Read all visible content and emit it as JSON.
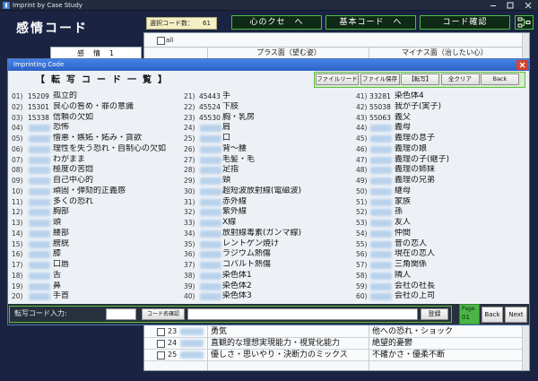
{
  "app": {
    "title": "Imprint by Case Study",
    "icons": {
      "app": "app-icon",
      "minimize": "minimize-icon",
      "maximize": "maximize-icon",
      "close": "close-icon"
    }
  },
  "colors": {
    "background": "#1a2442",
    "accent_green": "#4fbf3f",
    "dialog_title": "#3572d6",
    "close_red": "#d9412e",
    "count_box": "#f4efc4",
    "page_box": "#4cb548"
  },
  "main": {
    "heading": "感情コード",
    "selected_count_label": "選択コード数：",
    "selected_count": "61",
    "nav": [
      "心のクセ　へ",
      "基本コード　へ",
      "コード確認"
    ],
    "nav_icon": "network-icon",
    "group_label": "感　情　1",
    "all_label": "all",
    "columns": {
      "plus": "プラス面（望む姿）",
      "minus": "マイナス面（治したい心）"
    },
    "rows": [
      {
        "no": "23",
        "plus": "勇気",
        "minus": "他への恐れ・ショック"
      },
      {
        "no": "24",
        "plus": "直観的な理想実現能力・視覚化能力",
        "minus": "絶望的憂鬱"
      },
      {
        "no": "25",
        "plus": "優しさ・思いやり・決断力のミックス",
        "minus": "不確かさ・優柔不断"
      }
    ]
  },
  "dialog": {
    "title": "Imprinting Code",
    "close_icon": "close-icon",
    "heading": "【転写コード一覧】",
    "toolbar": [
      "ファイルリード",
      "ファイル保存",
      "【転写】",
      "全クリア",
      "Back"
    ],
    "list": [
      {
        "no": "01)",
        "code": "15209",
        "text": "孤立的"
      },
      {
        "no": "02)",
        "code": "15301",
        "text": "良心の咎め・罪の意識"
      },
      {
        "no": "03)",
        "code": "15338",
        "text": "信頼の欠如"
      },
      {
        "no": "04)",
        "code": "",
        "text": "恐怖"
      },
      {
        "no": "05)",
        "code": "",
        "text": "憎悪・嫉妬・妬み・貪欲"
      },
      {
        "no": "06)",
        "code": "",
        "text": "理性を失う恐れ・自制心の欠如"
      },
      {
        "no": "07)",
        "code": "",
        "text": "わがまま"
      },
      {
        "no": "08)",
        "code": "",
        "text": "極度の苦悶"
      },
      {
        "no": "09)",
        "code": "",
        "text": "自己中心的"
      },
      {
        "no": "10)",
        "code": "",
        "text": "頑固・弾劾的正義感"
      },
      {
        "no": "11)",
        "code": "",
        "text": "多くの恐れ"
      },
      {
        "no": "12)",
        "code": "",
        "text": "胸部"
      },
      {
        "no": "13)",
        "code": "",
        "text": "頭"
      },
      {
        "no": "14)",
        "code": "",
        "text": "腰部"
      },
      {
        "no": "15)",
        "code": "",
        "text": "膀胱"
      },
      {
        "no": "16)",
        "code": "",
        "text": "膝"
      },
      {
        "no": "17)",
        "code": "",
        "text": "口唇"
      },
      {
        "no": "18)",
        "code": "",
        "text": "舌"
      },
      {
        "no": "19)",
        "code": "",
        "text": "鼻"
      },
      {
        "no": "20)",
        "code": "",
        "text": "手首"
      },
      {
        "no": "21)",
        "code": "45443",
        "text": "手"
      },
      {
        "no": "22)",
        "code": "45524",
        "text": "下肢"
      },
      {
        "no": "23)",
        "code": "45530",
        "text": "胸・乳房"
      },
      {
        "no": "24)",
        "code": "",
        "text": "肩"
      },
      {
        "no": "25)",
        "code": "",
        "text": "口"
      },
      {
        "no": "26)",
        "code": "",
        "text": "背〜腰"
      },
      {
        "no": "27)",
        "code": "",
        "text": "毛髪・毛"
      },
      {
        "no": "28)",
        "code": "",
        "text": "足指"
      },
      {
        "no": "29)",
        "code": "",
        "text": "頸"
      },
      {
        "no": "30)",
        "code": "",
        "text": "超短波放射線(電磁波)"
      },
      {
        "no": "31)",
        "code": "",
        "text": "赤外線"
      },
      {
        "no": "32)",
        "code": "",
        "text": "紫外線"
      },
      {
        "no": "33)",
        "code": "",
        "text": "X線"
      },
      {
        "no": "34)",
        "code": "",
        "text": "放射線毒素(ガンマ線)"
      },
      {
        "no": "35)",
        "code": "",
        "text": "レントゲン焼け"
      },
      {
        "no": "36)",
        "code": "",
        "text": "ラジウム熱傷"
      },
      {
        "no": "37)",
        "code": "",
        "text": "コバルト熱傷"
      },
      {
        "no": "38)",
        "code": "",
        "text": "染色体1"
      },
      {
        "no": "39)",
        "code": "",
        "text": "染色体2"
      },
      {
        "no": "40)",
        "code": "",
        "text": "染色体3"
      },
      {
        "no": "41)",
        "code": "33281",
        "text": "染色体4"
      },
      {
        "no": "42)",
        "code": "55038",
        "text": "我が子(実子)"
      },
      {
        "no": "43)",
        "code": "55063",
        "text": "義父"
      },
      {
        "no": "44)",
        "code": "",
        "text": "義母"
      },
      {
        "no": "45)",
        "code": "",
        "text": "義理の息子"
      },
      {
        "no": "46)",
        "code": "",
        "text": "義理の娘"
      },
      {
        "no": "47)",
        "code": "",
        "text": "義理の子(継子)"
      },
      {
        "no": "48)",
        "code": "",
        "text": "義理の姉妹"
      },
      {
        "no": "49)",
        "code": "",
        "text": "義理の兄弟"
      },
      {
        "no": "50)",
        "code": "",
        "text": "継母"
      },
      {
        "no": "51)",
        "code": "",
        "text": "家族"
      },
      {
        "no": "52)",
        "code": "",
        "text": "孫"
      },
      {
        "no": "53)",
        "code": "",
        "text": "友人"
      },
      {
        "no": "54)",
        "code": "",
        "text": "仲間"
      },
      {
        "no": "55)",
        "code": "",
        "text": "昔の恋人"
      },
      {
        "no": "56)",
        "code": "",
        "text": "現在の恋人"
      },
      {
        "no": "57)",
        "code": "",
        "text": "三角関係"
      },
      {
        "no": "58)",
        "code": "",
        "text": "隣人"
      },
      {
        "no": "59)",
        "code": "",
        "text": "会社の社長"
      },
      {
        "no": "60)",
        "code": "",
        "text": "会社の上司"
      }
    ],
    "footer": {
      "input_label": "転写コード入力:",
      "code_value": "",
      "check_button": "コード名確認",
      "name_value": "",
      "register_button": "登録",
      "page_label": "Page",
      "page_number": "01",
      "back_button": "Back",
      "next_button": "Next"
    }
  }
}
